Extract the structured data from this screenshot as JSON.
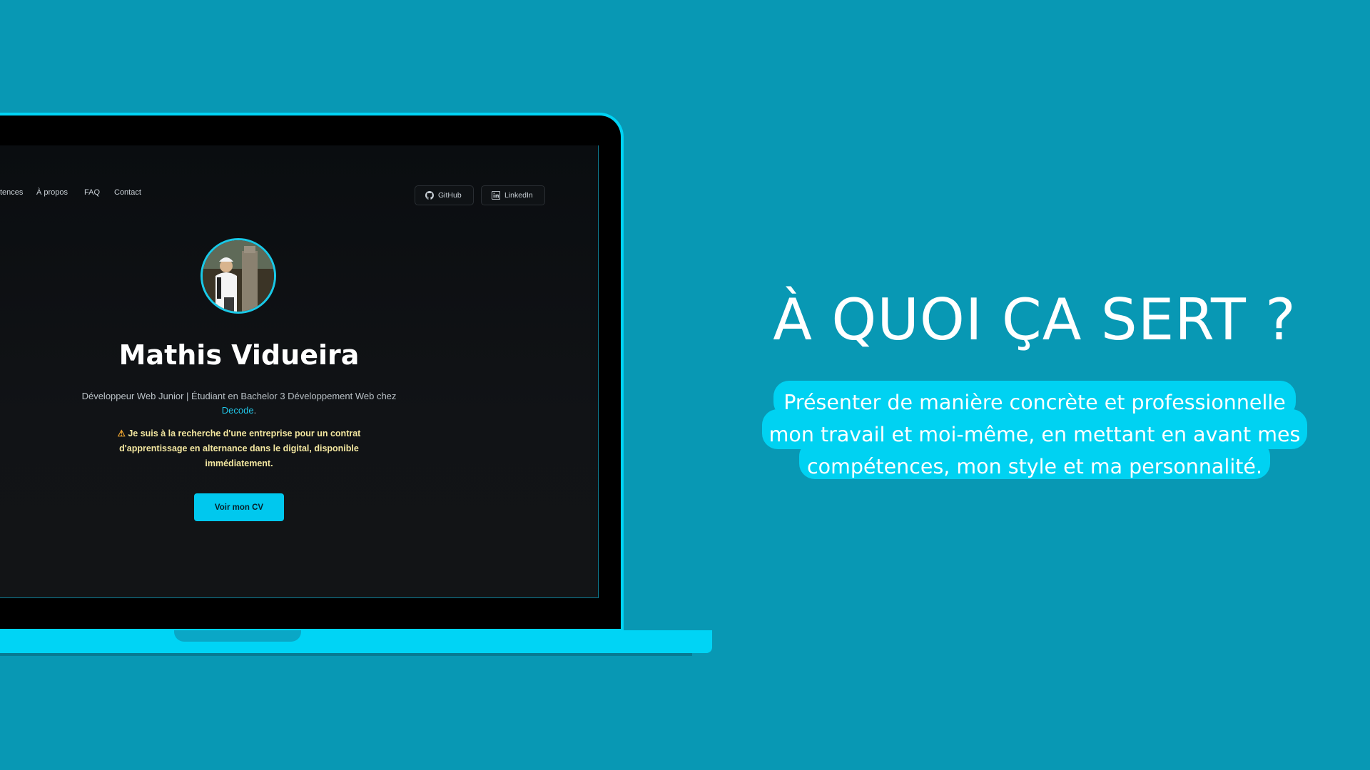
{
  "nav": {
    "items": [
      "tences",
      "À propos",
      "FAQ",
      "Contact"
    ],
    "github_label": "GitHub",
    "linkedin_label": "LinkedIn"
  },
  "hero": {
    "name": "Mathis Vidueira",
    "subtitle_prefix": "Développeur Web Junior | Étudiant en Bachelor 3 Développement Web chez",
    "subtitle_link": "Decode",
    "subtitle_suffix": ".",
    "notice_icon": "⚠",
    "notice": "Je suis à la recherche d'une entreprise pour un contrat d'apprentissage en alternance dans le digital, disponible immédiatement.",
    "cv_button": "Voir mon CV"
  },
  "right": {
    "headline": "À QUOI ÇA SERT ?",
    "description_lines": [
      "Présenter de manière concrète et professionnelle",
      "mon travail et moi-même, en mettant en avant mes",
      "compétences, mon style et ma personnalité."
    ]
  },
  "colors": {
    "background": "#0898b4",
    "accent": "#00d4f5",
    "screen": "#111316"
  }
}
